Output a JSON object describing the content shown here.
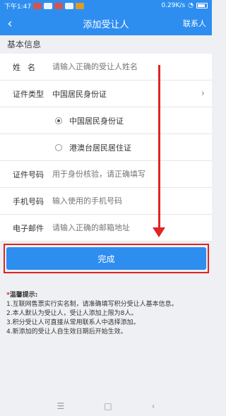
{
  "status_bar": {
    "time": "下午1:47",
    "speed": "0.29K/s"
  },
  "nav": {
    "back_icon": "chevron-left-icon",
    "title": "添加受让人",
    "action": "联系人"
  },
  "section_title": "基本信息",
  "form": {
    "name": {
      "label": "姓名",
      "placeholder": "请输入正确的受让人姓名"
    },
    "id_type": {
      "label": "证件类型",
      "value": "中国居民身份证"
    },
    "id_options": [
      {
        "label": "中国居民身份证",
        "checked": true
      },
      {
        "label": "港澳台居民居住证",
        "checked": false
      }
    ],
    "id_number": {
      "label": "证件号码",
      "placeholder": "用于身份核验，请正确填写"
    },
    "phone": {
      "label": "手机号码",
      "placeholder": "输入使用的手机号码"
    },
    "email": {
      "label": "电子邮件",
      "placeholder": "请输入正确的邮箱地址"
    }
  },
  "submit_label": "完成",
  "tips": {
    "star": "*",
    "title": "温馨提示:",
    "items": [
      "1.互联网售票实行实名制，请准确填写积分受让人基本信息。",
      "2.本人默认为受让人，受让人添加上限为8人。",
      "3.积分受让人可直接从常用联系人中选择添加。",
      "4.新添加的受让人自生效日期后开始生效。"
    ]
  },
  "android_nav": {
    "menu": "☰",
    "home": "□",
    "back": "‹"
  },
  "colors": {
    "primary": "#2e8ef0",
    "annotation": "#e02424"
  }
}
